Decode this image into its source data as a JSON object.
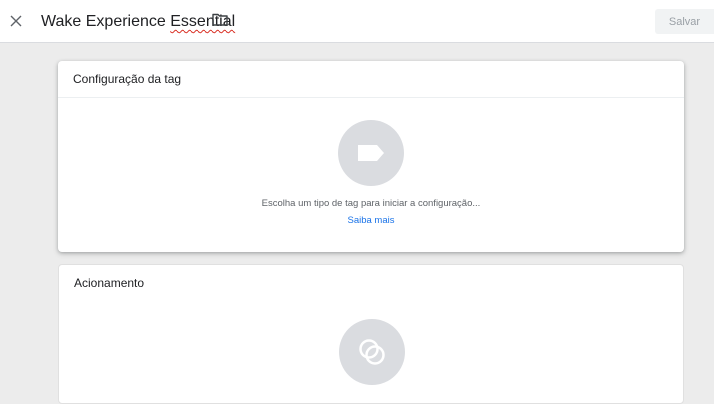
{
  "header": {
    "title_main": "Wake Experience ",
    "title_spell": "Essential",
    "save_label": "Salvar"
  },
  "icons": {
    "close": "close-icon",
    "folder": "folder-icon",
    "tag": "tag-icon",
    "trigger": "trigger-icon"
  },
  "tag_config": {
    "title": "Configuração da tag",
    "hint": "Escolha um tipo de tag para iniciar a configuração...",
    "learn_more": "Saiba mais"
  },
  "trigger": {
    "title": "Acionamento"
  },
  "colors": {
    "accent": "#1a73e8",
    "background": "#ececec",
    "placeholder_circle": "#dadce0"
  }
}
